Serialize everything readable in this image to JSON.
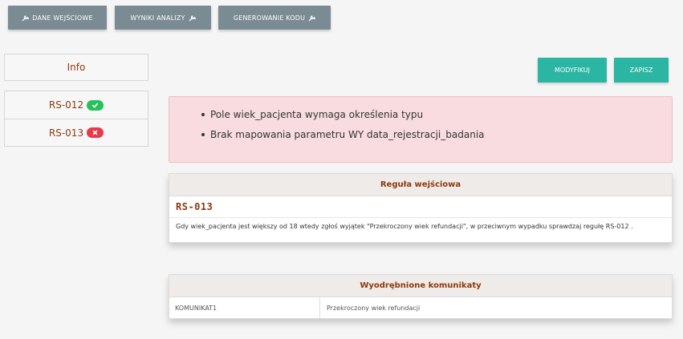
{
  "toolbar": {
    "input_data_label": "DANE WEJŚCIOWE",
    "analysis_results_label": "WYNIKI ANALIZY",
    "code_generation_label": "GENEROWANIE KODU",
    "icon": "wrench-icon",
    "button_color": "#7b8b94"
  },
  "sidebar": {
    "header": "Info",
    "rules": [
      {
        "id": "RS-012",
        "status": "ok",
        "status_icon": "check-icon"
      },
      {
        "id": "RS-013",
        "status": "error",
        "status_icon": "x-icon"
      }
    ]
  },
  "actions": {
    "modify_label": "MODYFIKUJ",
    "save_label": "ZAPISZ",
    "color": "#2bb5a3"
  },
  "alert": {
    "items": [
      "Pole wiek_pacjenta wymaga określenia typu",
      "Brak mapowania parametru WY data_rejestracji_badania"
    ],
    "background": "#f8dce0"
  },
  "rule_panel": {
    "title": "Reguła wejściowa",
    "rule_name": "RS-013",
    "description": "Gdy wiek_pacjenta jest większy od 18 wtedy zgłoś wyjątek \"Przekroczony wiek refundacji\", w przeciwnym wypadku sprawdzaj regułę RS-012 ."
  },
  "messages_panel": {
    "title": "Wyodrębnione komunikaty",
    "rows": [
      {
        "key": "KOMUNIKAT1",
        "value": "Przekroczony wiek refundacji"
      }
    ]
  },
  "colors": {
    "accent_text": "#8b3a0e",
    "success": "#27c15a",
    "danger": "#e8394b"
  }
}
